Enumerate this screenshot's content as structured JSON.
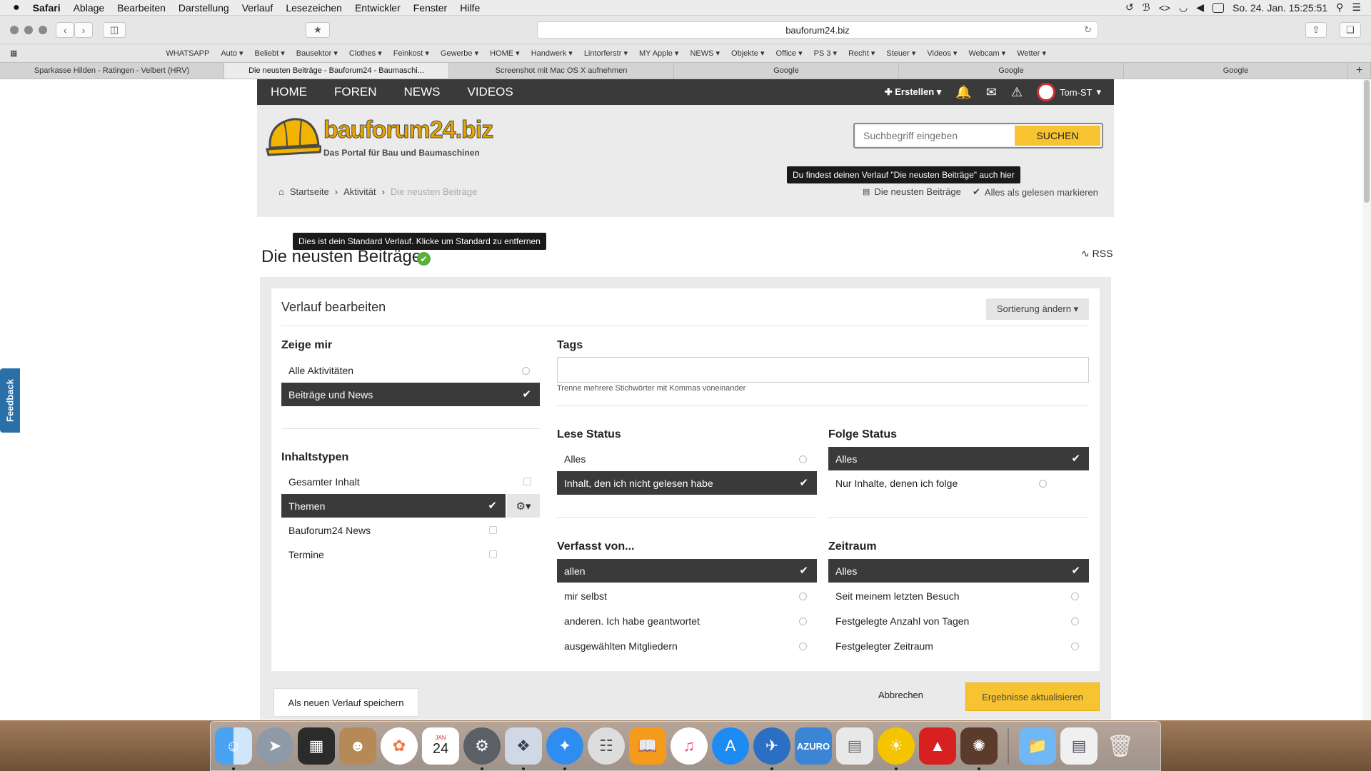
{
  "menubar": {
    "apple": "",
    "app": "Safari",
    "items": [
      "Ablage",
      "Bearbeiten",
      "Darstellung",
      "Verlauf",
      "Lesezeichen",
      "Entwickler",
      "Fenster",
      "Hilfe"
    ],
    "clock": "So. 24. Jan.  15:25:51"
  },
  "browser": {
    "url": "bauforum24.biz"
  },
  "bookmarks": [
    "WHATSAPP",
    "Auto ▾",
    "Beliebt ▾",
    "Bausektor ▾",
    "Clothes ▾",
    "Feinkost ▾",
    "Gewerbe ▾",
    "HOME ▾",
    "Handwerk ▾",
    "Lintorferstr ▾",
    "MY Apple ▾",
    "NEWS ▾",
    "Objekte ▾",
    "Office ▾",
    "PS 3 ▾",
    "Recht ▾",
    "Steuer ▾",
    "Videos ▾",
    "Webcam ▾",
    "Wetter ▾"
  ],
  "tabs": [
    {
      "label": "Sparkasse Hilden - Ratingen - Velbert (HRV)",
      "active": false
    },
    {
      "label": "Die neusten Beiträge - Bauforum24 - Baumaschi...",
      "active": true
    },
    {
      "label": "Screenshot mit Mac OS X aufnehmen",
      "active": false
    },
    {
      "label": "Google",
      "active": false
    },
    {
      "label": "Google",
      "active": false
    },
    {
      "label": "Google",
      "active": false
    }
  ],
  "nav": {
    "items": [
      "HOME",
      "FOREN",
      "NEWS",
      "VIDEOS"
    ],
    "create": "Erstellen",
    "user": "Tom-ST"
  },
  "logo": {
    "name": "bauforum24.biz",
    "tagline": "Das Portal für Bau und Baumaschinen"
  },
  "search": {
    "placeholder": "Suchbegriff eingeben",
    "button": "SUCHEN"
  },
  "tooltips": {
    "stream_hint": "Du findest deinen Verlauf \"Die neusten Beiträge\" auch hier",
    "default_hint": "Dies ist dein Standard Verlauf. Klicke um Standard zu entfernen"
  },
  "breadcrumb": {
    "items": [
      "Startseite",
      "Aktivität"
    ],
    "current": "Die neusten Beiträge"
  },
  "header_links": {
    "newest": "Die neusten Beiträge",
    "mark_read": "Alles als gelesen markieren"
  },
  "page": {
    "title": "Die neusten Beiträge",
    "rss": "RSS"
  },
  "panel": {
    "title": "Verlauf bearbeiten",
    "sort": "Sortierung ändern ▾",
    "show_me": {
      "heading": "Zeige mir",
      "options": [
        "Alle Aktivitäten",
        "Beiträge und News"
      ]
    },
    "content_types": {
      "heading": "Inhaltstypen",
      "options": [
        "Gesamter Inhalt",
        "Themen",
        "Bauforum24 News",
        "Termine"
      ]
    },
    "tags": {
      "heading": "Tags",
      "hint": "Trenne mehrere Stichwörter mit Kommas voneinander"
    },
    "read_status": {
      "heading": "Lese Status",
      "options": [
        "Alles",
        "Inhalt, den ich nicht gelesen habe"
      ]
    },
    "follow_status": {
      "heading": "Folge Status",
      "options": [
        "Alles",
        "Nur Inhalte, denen ich folge"
      ]
    },
    "author": {
      "heading": "Verfasst von...",
      "options": [
        "allen",
        "mir selbst",
        "anderen. Ich habe geantwortet",
        "ausgewählten Mitgliedern"
      ]
    },
    "period": {
      "heading": "Zeitraum",
      "options": [
        "Alles",
        "Seit meinem letzten Besuch",
        "Festgelegte Anzahl von Tagen",
        "Festgelegter Zeitraum"
      ]
    }
  },
  "actions": {
    "save_new": "Als neuen Verlauf speichern",
    "cancel": "Abbrechen",
    "update": "Ergebnisse aktualisieren"
  },
  "feedback": "Feedback",
  "dock": {
    "calendar_month": "JAN",
    "calendar_day": "24",
    "azuro": "AZURO"
  },
  "colors": {
    "accent": "#f7c331",
    "nav_bg": "#3a3a3a",
    "selected_bg": "#3a3a3a",
    "check_green": "#5cae3b",
    "feedback_blue": "#2a6fa8"
  }
}
